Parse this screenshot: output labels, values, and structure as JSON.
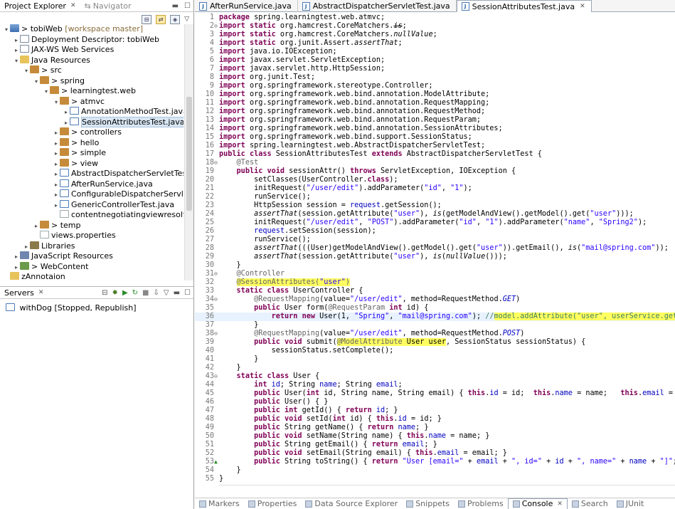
{
  "left_tabs": {
    "project_explorer": "Project Explorer",
    "navigator": "Navigator"
  },
  "tree": [
    {
      "depth": 0,
      "exp": "▾",
      "icon": "proj",
      "label": "> tobiWeb",
      "suffix": " [workspace master]"
    },
    {
      "depth": 1,
      "exp": "▸",
      "icon": "java",
      "label": "Deployment Descriptor: tobiWeb",
      "suffix": ""
    },
    {
      "depth": 1,
      "exp": "▸",
      "icon": "java",
      "label": "JAX-WS Web Services",
      "suffix": ""
    },
    {
      "depth": 1,
      "exp": "▾",
      "icon": "folder",
      "label": "Java Resources",
      "suffix": ""
    },
    {
      "depth": 2,
      "exp": "▾",
      "icon": "pkg",
      "label": "> src",
      "suffix": ""
    },
    {
      "depth": 3,
      "exp": "▾",
      "icon": "pkg",
      "label": "> spring",
      "suffix": ""
    },
    {
      "depth": 4,
      "exp": "▾",
      "icon": "pkg",
      "label": "> learningtest.web",
      "suffix": ""
    },
    {
      "depth": 5,
      "exp": "▾",
      "icon": "pkg",
      "label": "> atmvc",
      "suffix": ""
    },
    {
      "depth": 6,
      "exp": "▸",
      "icon": "jfile",
      "label": "AnnotationMethodTest.java",
      "suffix": ""
    },
    {
      "depth": 6,
      "exp": "▸",
      "icon": "jfile",
      "label": "SessionAttributesTest.java",
      "suffix": "",
      "selected": true
    },
    {
      "depth": 5,
      "exp": "▸",
      "icon": "pkg",
      "label": "> controllers",
      "suffix": ""
    },
    {
      "depth": 5,
      "exp": "▸",
      "icon": "pkg",
      "label": "> hello",
      "suffix": ""
    },
    {
      "depth": 5,
      "exp": "▸",
      "icon": "pkg",
      "label": "> simple",
      "suffix": ""
    },
    {
      "depth": 5,
      "exp": "▸",
      "icon": "pkg",
      "label": "> view",
      "suffix": ""
    },
    {
      "depth": 5,
      "exp": "▸",
      "icon": "jfile",
      "label": "AbstractDispatcherServletTest.java",
      "suffix": ""
    },
    {
      "depth": 5,
      "exp": "▸",
      "icon": "jfile",
      "label": "AfterRunService.java",
      "suffix": ""
    },
    {
      "depth": 5,
      "exp": "▸",
      "icon": "jfile",
      "label": "ConfigurableDispatcherServlet.java",
      "suffix": ""
    },
    {
      "depth": 5,
      "exp": "▸",
      "icon": "jfile",
      "label": "GenericControllerTest.java",
      "suffix": ""
    },
    {
      "depth": 5,
      "exp": "",
      "icon": "xml",
      "label": "contentnegotiatingviewresolver.xml",
      "suffix": ""
    },
    {
      "depth": 3,
      "exp": "▸",
      "icon": "pkg",
      "label": "> temp",
      "suffix": ""
    },
    {
      "depth": 3,
      "exp": "",
      "icon": "xml",
      "label": "views.properties",
      "suffix": ""
    },
    {
      "depth": 2,
      "exp": "▸",
      "icon": "lib",
      "label": "Libraries",
      "suffix": ""
    },
    {
      "depth": 1,
      "exp": "▸",
      "icon": "js",
      "label": "JavaScript Resources",
      "suffix": ""
    },
    {
      "depth": 1,
      "exp": "▸",
      "icon": "web",
      "label": "> WebContent",
      "suffix": ""
    },
    {
      "depth": 0,
      "exp": "",
      "icon": "folder",
      "label": "zAnnotaion",
      "suffix": ""
    }
  ],
  "servers": {
    "tab": "Servers",
    "row": "withDog  [Stopped, Republish]"
  },
  "editor_tabs": [
    {
      "label": "AfterRunService.java",
      "active": false
    },
    {
      "label": "AbstractDispatcherServletTest.java",
      "active": false
    },
    {
      "label": "SessionAttributesTest.java",
      "active": true
    }
  ],
  "code_lines": [
    {
      "n": "1",
      "f": "",
      "h": "<span class=\"kw\">package</span> spring.learningtest.web.atmvc;"
    },
    {
      "n": "2",
      "f": "⊖",
      "h": "<span class=\"kw\">import</span> <span class=\"kw\">static</span> org.hamcrest.CoreMatchers.<span class=\"ital\" style=\"text-decoration:line-through\">is</span>;"
    },
    {
      "n": "3",
      "f": "",
      "h": "<span class=\"kw\">import</span> <span class=\"kw\">static</span> org.hamcrest.CoreMatchers.<span class=\"ital\">nullValue</span>;"
    },
    {
      "n": "4",
      "f": "",
      "h": "<span class=\"kw\">import</span> <span class=\"kw\">static</span> org.junit.Assert.<span class=\"ital\">assertThat</span>;"
    },
    {
      "n": "5",
      "f": "",
      "h": "<span class=\"kw\">import</span> java.io.IOException;"
    },
    {
      "n": "6",
      "f": "",
      "h": "<span class=\"kw\">import</span> javax.servlet.ServletException;"
    },
    {
      "n": "7",
      "f": "",
      "h": "<span class=\"kw\">import</span> javax.servlet.http.HttpSession;"
    },
    {
      "n": "8",
      "f": "",
      "h": "<span class=\"kw\">import</span> org.junit.Test;"
    },
    {
      "n": "9",
      "f": "",
      "h": "<span class=\"kw\">import</span> org.springframework.stereotype.Controller;"
    },
    {
      "n": "10",
      "f": "",
      "h": "<span class=\"kw\">import</span> org.springframework.web.bind.annotation.ModelAttribute;"
    },
    {
      "n": "11",
      "f": "",
      "h": "<span class=\"kw\">import</span> org.springframework.web.bind.annotation.RequestMapping;"
    },
    {
      "n": "12",
      "f": "",
      "h": "<span class=\"kw\">import</span> org.springframework.web.bind.annotation.RequestMethod;"
    },
    {
      "n": "13",
      "f": "",
      "h": "<span class=\"kw\">import</span> org.springframework.web.bind.annotation.RequestParam;"
    },
    {
      "n": "14",
      "f": "",
      "h": "<span class=\"kw\">import</span> org.springframework.web.bind.annotation.SessionAttributes;"
    },
    {
      "n": "15",
      "f": "",
      "h": "<span class=\"kw\">import</span> org.springframework.web.bind.support.SessionStatus;"
    },
    {
      "n": "16",
      "f": "",
      "h": "<span class=\"kw\">import</span> spring.learningtest.web.AbstractDispatcherServletTest;"
    },
    {
      "n": "17",
      "f": "",
      "h": "<span class=\"kw\">public</span> <span class=\"kw\">class</span> SessionAttributesTest <span class=\"kw\">extends</span> AbstractDispatcherServletTest {"
    },
    {
      "n": "18",
      "f": "⊖",
      "h": "    <span class=\"ann\">@Test</span>"
    },
    {
      "n": "19",
      "f": "",
      "h": "    <span class=\"kw\">public</span> <span class=\"kw\">void</span> sessionAttr() <span class=\"kw\">throws</span> ServletException, IOException {"
    },
    {
      "n": "20",
      "f": "",
      "h": "        setClasses(UserController.<span class=\"kw\">class</span>);"
    },
    {
      "n": "21",
      "f": "",
      "h": "        initRequest(<span class=\"str\">\"/user/edit\"</span>).addParameter(<span class=\"str\">\"id\"</span>, <span class=\"str\">\"1\"</span>);"
    },
    {
      "n": "22",
      "f": "",
      "h": "        runService();"
    },
    {
      "n": "23",
      "f": "",
      "h": "        HttpSession session = <span class=\"fld\">request</span>.getSession();"
    },
    {
      "n": "24",
      "f": "",
      "h": "        <span class=\"ital\">assertThat</span>(session.getAttribute(<span class=\"str\">\"user\"</span>), <span class=\"ital\">is</span>(getModelAndView().getModel().get(<span class=\"str\">\"user\"</span>)));"
    },
    {
      "n": "25",
      "f": "",
      "h": "        initRequest(<span class=\"str\">\"/user/edit\"</span>, <span class=\"str\">\"POST\"</span>).addParameter(<span class=\"str\">\"id\"</span>, <span class=\"str\">\"1\"</span>).addParameter(<span class=\"str\">\"name\"</span>, <span class=\"str\">\"Spring2\"</span>);"
    },
    {
      "n": "26",
      "f": "",
      "h": "        <span class=\"fld\">request</span>.setSession(session);"
    },
    {
      "n": "27",
      "f": "",
      "h": "        runService();"
    },
    {
      "n": "28",
      "f": "",
      "h": "        <span class=\"ital\">assertThat</span>(((User)getModelAndView().getModel().get(<span class=\"str\">\"user\"</span>)).getEmail(), <span class=\"ital\">is</span>(<span class=\"str\">\"mail@spring.com\"</span>));"
    },
    {
      "n": "29",
      "f": "",
      "h": "        <span class=\"ital\">assertThat</span>(session.getAttribute(<span class=\"str\">\"user\"</span>), <span class=\"ital\">is</span>(<span class=\"ital\">nullValue</span>()));"
    },
    {
      "n": "30",
      "f": "",
      "h": "    }"
    },
    {
      "n": "31",
      "f": "⊖",
      "h": "    <span class=\"ann\">@Controller</span>"
    },
    {
      "n": "32",
      "f": "",
      "h": "    <span class=\"ann hl\">@SessionAttributes(<span class=\"str\">\"user\"</span>)</span>"
    },
    {
      "n": "33",
      "f": "",
      "h": "    <span class=\"kw\">static</span> <span class=\"kw\">class</span> UserController {"
    },
    {
      "n": "34",
      "f": "⊖",
      "h": "        <span class=\"ann\">@RequestMapping</span>(value=<span class=\"str\">\"/user/edit\"</span>, method=RequestMethod.<span class=\"fld ital\">GET</span>)"
    },
    {
      "n": "35",
      "f": "",
      "h": "        <span class=\"kw\">public</span> User form(<span class=\"ann\">@RequestParam</span> <span class=\"kw\">int</span> id) {"
    },
    {
      "n": "36",
      "f": "",
      "h": "            <span class=\"kw\">return</span> <span class=\"kw\">new</span> User(1, <span class=\"str\">\"Spring\"</span>, <span class=\"str\">\"mail@spring.com\"</span>); <span class=\"cm\">//<span class=\"hl\">model.addAttribute(\"user\", userService.getUser(id</span></span>",
      "current": true
    },
    {
      "n": "37",
      "f": "",
      "h": "        }"
    },
    {
      "n": "38",
      "f": "⊖",
      "h": "        <span class=\"ann\">@RequestMapping</span>(value=<span class=\"str\">\"/user/edit\"</span>, method=RequestMethod.<span class=\"fld ital\">POST</span>)"
    },
    {
      "n": "39",
      "f": "",
      "h": "        <span class=\"kw\">public</span> <span class=\"kw\">void</span> submit(<span class=\"hl\"><span class=\"ann\">@ModelAttribute</span> User user</span>, SessionStatus sessionStatus) {"
    },
    {
      "n": "40",
      "f": "",
      "h": "            sessionStatus.setComplete();"
    },
    {
      "n": "41",
      "f": "",
      "h": "        }"
    },
    {
      "n": "42",
      "f": "",
      "h": "    }"
    },
    {
      "n": "43",
      "f": "⊖",
      "h": "    <span class=\"kw\">static</span> <span class=\"kw\">class</span> User {"
    },
    {
      "n": "44",
      "f": "",
      "h": "        <span class=\"kw\">int</span> <span class=\"fld\">id</span>; String <span class=\"fld\">name</span>; String <span class=\"fld\">email</span>;"
    },
    {
      "n": "45",
      "f": "",
      "h": "        <span class=\"kw\">public</span> User(<span class=\"kw\">int</span> id, String name, String email) { <span class=\"kw\">this</span>.<span class=\"fld\">id</span> = id;  <span class=\"kw\">this</span>.<span class=\"fld\">name</span> = name;   <span class=\"kw\">this</span>.<span class=\"fld\">email</span> = email;}"
    },
    {
      "n": "46",
      "f": "",
      "h": "        <span class=\"kw\">public</span> User() { }"
    },
    {
      "n": "47",
      "f": "",
      "h": "        <span class=\"kw\">public</span> <span class=\"kw\">int</span> getId() { <span class=\"kw\">return</span> <span class=\"fld\">id</span>; }"
    },
    {
      "n": "48",
      "f": "",
      "h": "        <span class=\"kw\">public</span> <span class=\"kw\">void</span> setId(<span class=\"kw\">int</span> id) { <span class=\"kw\">this</span>.<span class=\"fld\">id</span> = id; }"
    },
    {
      "n": "49",
      "f": "",
      "h": "        <span class=\"kw\">public</span> String getName() { <span class=\"kw\">return</span> <span class=\"fld\">name</span>; }"
    },
    {
      "n": "50",
      "f": "",
      "h": "        <span class=\"kw\">public</span> <span class=\"kw\">void</span> setName(String name) { <span class=\"kw\">this</span>.<span class=\"fld\">name</span> = name; }"
    },
    {
      "n": "51",
      "f": "",
      "h": "        <span class=\"kw\">public</span> String getEmail() { <span class=\"kw\">return</span> <span class=\"fld\">email</span>; }"
    },
    {
      "n": "52",
      "f": "",
      "h": "        <span class=\"kw\">public</span> <span class=\"kw\">void</span> setEmail(String email) { <span class=\"kw\">this</span>.<span class=\"fld\">email</span> = email; }"
    },
    {
      "n": "53",
      "f": "▲",
      "h": "        <span class=\"kw\">public</span> String toString() { <span class=\"kw\">return</span> <span class=\"str\">\"User [email=\"</span> + <span class=\"fld\">email</span> + <span class=\"str\">\", id=\"</span> + <span class=\"fld\">id</span> + <span class=\"str\">\", name=\"</span> + <span class=\"fld\">name</span> + <span class=\"str\">\"]\"</span>;  }"
    },
    {
      "n": "54",
      "f": "",
      "h": "    }"
    },
    {
      "n": "55",
      "f": "",
      "h": "}"
    }
  ],
  "bottom_tabs": [
    {
      "label": "Markers",
      "active": false
    },
    {
      "label": "Properties",
      "active": false
    },
    {
      "label": "Data Source Explorer",
      "active": false
    },
    {
      "label": "Snippets",
      "active": false
    },
    {
      "label": "Problems",
      "active": false
    },
    {
      "label": "Console",
      "active": true
    },
    {
      "label": "Search",
      "active": false
    },
    {
      "label": "JUnit",
      "active": false
    }
  ]
}
